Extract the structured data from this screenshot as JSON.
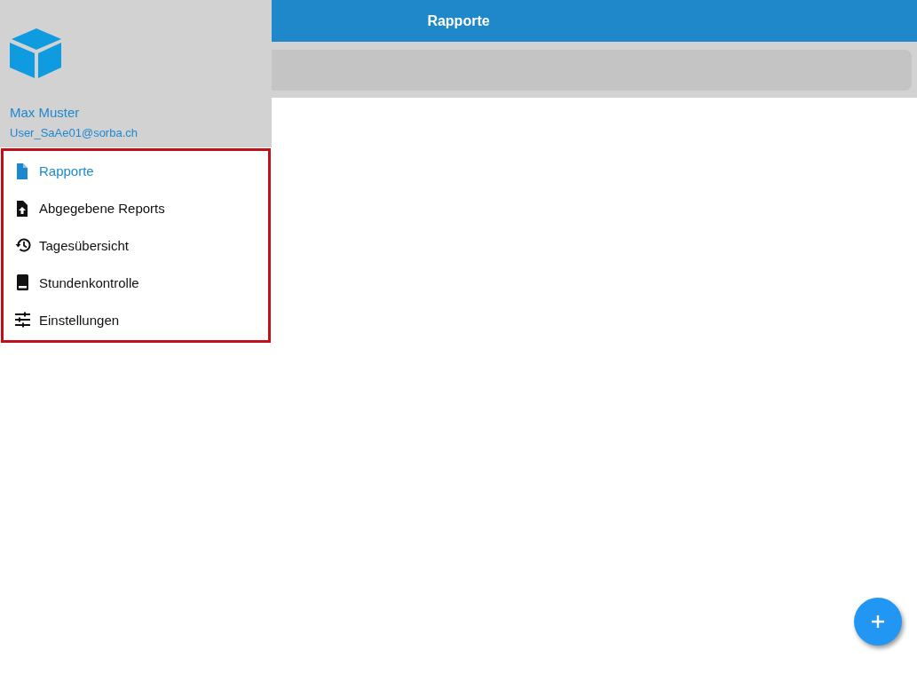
{
  "header": {
    "title": "Rapporte"
  },
  "drawer": {
    "user_name": "Max Muster",
    "user_email": "User_SaAe01@sorba.ch",
    "items": [
      {
        "kind": "file",
        "label": "Rapporte",
        "selected": true
      },
      {
        "kind": "upload",
        "label": "Abgegebene Reports",
        "selected": false
      },
      {
        "kind": "history",
        "label": "Tagesübersicht",
        "selected": false
      },
      {
        "kind": "book",
        "label": "Stundenkontrolle",
        "selected": false
      },
      {
        "kind": "sliders",
        "label": "Einstellungen",
        "selected": false
      }
    ]
  }
}
